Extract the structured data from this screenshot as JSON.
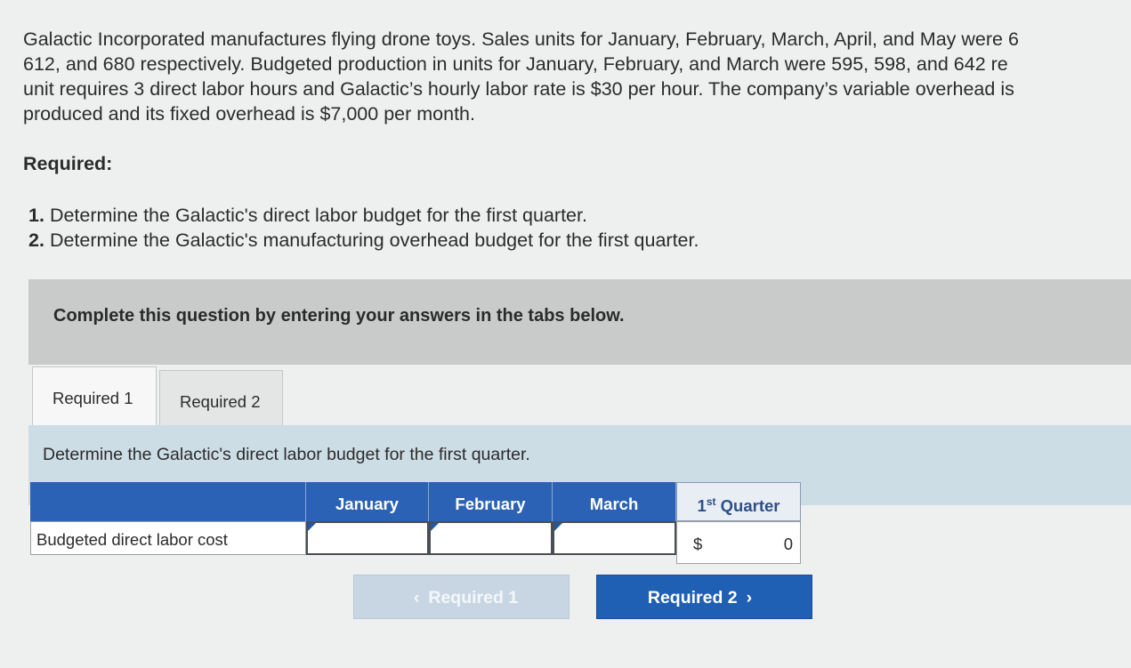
{
  "problem": {
    "lines": [
      "Galactic Incorporated manufactures flying drone toys. Sales units for January, February, March, April, and May were 6",
      "612, and 680  respectively. Budgeted production in units for January, February, and March were 595, 598, and 642 re",
      "unit requires 3 direct labor hours and Galactic’s hourly labor rate is $30 per hour. The company’s variable overhead is",
      "produced and its fixed overhead is $7,000 per month."
    ]
  },
  "required": {
    "heading": "Required:",
    "items": [
      {
        "num": "1.",
        "text": "Determine the Galactic's direct labor budget for the first quarter."
      },
      {
        "num": "2.",
        "text": "Determine the Galactic's manufacturing overhead budget for the first quarter."
      }
    ]
  },
  "banner": {
    "text": "Complete this question by entering your answers in the tabs below."
  },
  "tabs": [
    {
      "label": "Required 1",
      "active": true
    },
    {
      "label": "Required 2",
      "active": false
    }
  ],
  "instruction": "Determine the Galactic's direct labor budget for the first quarter.",
  "table": {
    "columns": [
      "January",
      "February",
      "March"
    ],
    "quarter_header": {
      "prefix": "1",
      "sup": "st",
      "suffix": " Quarter"
    },
    "row_label": "Budgeted direct labor cost",
    "inputs": {
      "january": "",
      "february": "",
      "march": ""
    },
    "total_currency": "$",
    "total_value": "0"
  },
  "nav": {
    "prev_label": "Required 1",
    "next_label": "Required 2",
    "prev_icon": "chevron-left-icon",
    "next_icon": "chevron-right-icon"
  },
  "colors": {
    "header_blue": "#2c62b5",
    "next_button": "#1f5fb4",
    "instruction_bg": "#cddde6",
    "banner_bg": "#c9cbcb"
  }
}
